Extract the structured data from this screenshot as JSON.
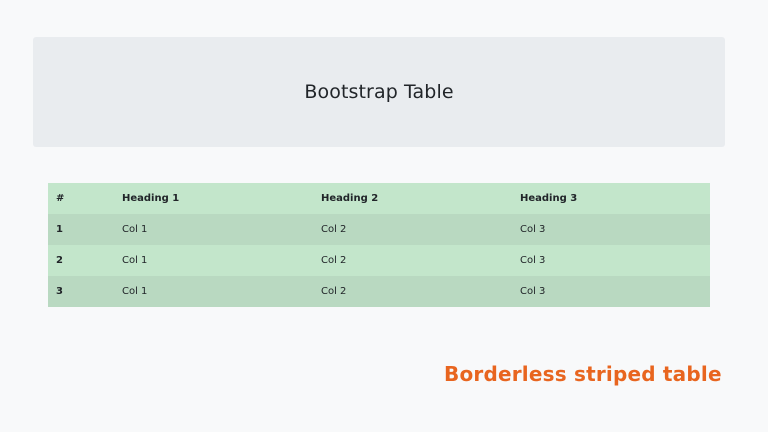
{
  "jumbotron": {
    "title": "Bootstrap Table"
  },
  "table": {
    "headers": [
      "#",
      "Heading 1",
      "Heading 2",
      "Heading 3"
    ],
    "rows": [
      [
        "1",
        "Col 1",
        "Col 2",
        "Col 3"
      ],
      [
        "2",
        "Col 1",
        "Col 2",
        "Col 3"
      ],
      [
        "3",
        "Col 1",
        "Col 2",
        "Col 3"
      ]
    ],
    "colors": {
      "light": "#c3e6cb",
      "dark": "#b9d9c1"
    }
  },
  "caption": "Borderless striped table",
  "colors": {
    "page_background": "#f8f9fa",
    "jumbotron_background": "#e9ecef",
    "caption": "#e8651f"
  }
}
